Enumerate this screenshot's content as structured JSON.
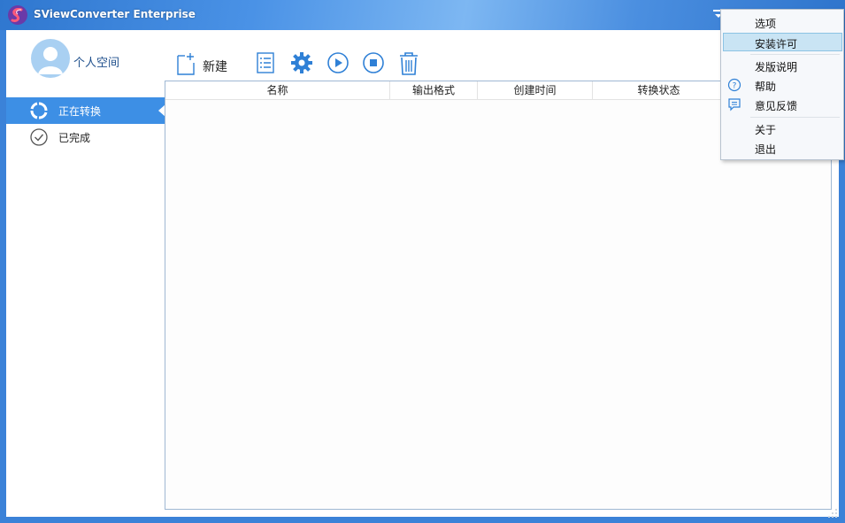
{
  "window": {
    "title": "SViewConverter Enterprise",
    "controls": [
      "menu",
      "minimize",
      "restore",
      "close"
    ]
  },
  "sidebar": {
    "user_label": "个人空间",
    "items": [
      {
        "label": "正在转换",
        "icon": "refresh-icon",
        "active": true
      },
      {
        "label": "已完成",
        "icon": "check-circle-icon",
        "active": false
      }
    ]
  },
  "toolbar": {
    "new_label": "新建",
    "buttons": [
      "new-file-icon",
      "list-icon",
      "gear-icon",
      "play-icon",
      "stop-icon",
      "trash-icon"
    ]
  },
  "table": {
    "columns": [
      "名称",
      "输出格式",
      "创建时间",
      "转换状态"
    ],
    "rows": []
  },
  "menu": {
    "items": [
      {
        "label": "选项",
        "highlighted": false,
        "icon": ""
      },
      {
        "label": "安装许可",
        "highlighted": true,
        "icon": ""
      },
      {
        "label": "发版说明",
        "highlighted": false,
        "icon": ""
      },
      {
        "label": "帮助",
        "highlighted": false,
        "icon": "help-icon"
      },
      {
        "label": "意见反馈",
        "highlighted": false,
        "icon": "feedback-icon"
      },
      {
        "label": "关于",
        "highlighted": false,
        "icon": ""
      },
      {
        "label": "退出",
        "highlighted": false,
        "icon": ""
      }
    ]
  },
  "colors": {
    "accent": "#3d8fe5",
    "titlebar": "#3b82d8",
    "menu_highlight": "#c9e4f4"
  }
}
